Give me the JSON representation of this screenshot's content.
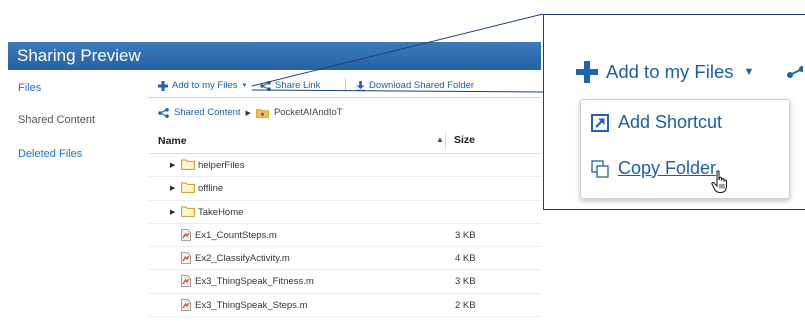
{
  "app": {
    "title": "Sharing Preview"
  },
  "sidebar": {
    "items": [
      {
        "label": "Files"
      },
      {
        "label": "Shared Content"
      },
      {
        "label": "Deleted Files"
      }
    ]
  },
  "toolbar": {
    "add_label": "Add to my Files",
    "share_label": "Share Link",
    "download_label": "Download Shared Folder"
  },
  "breadcrumb": {
    "root": "Shared Content",
    "current": "PocketAIAndIoT"
  },
  "table": {
    "headers": {
      "name": "Name",
      "size": "Size"
    },
    "folders": [
      {
        "name": "helperFiles"
      },
      {
        "name": "offline"
      },
      {
        "name": "TakeHome"
      }
    ],
    "files": [
      {
        "name": "Ex1_CountSteps.m",
        "size": "3 KB"
      },
      {
        "name": "Ex2_ClassifyActivity.m",
        "size": "4 KB"
      },
      {
        "name": "Ex3_ThingSpeak_Fitness.m",
        "size": "3 KB"
      },
      {
        "name": "Ex3_ThingSpeak_Steps.m",
        "size": "2 KB"
      }
    ]
  },
  "callout": {
    "add_label": "Add to my Files",
    "menu": [
      {
        "label": "Add Shortcut"
      },
      {
        "label": "Copy Folder"
      }
    ]
  },
  "colors": {
    "accent": "#1a5fa8",
    "titlebar": "#2b6cb0",
    "callout_border": "#1e3f73"
  }
}
